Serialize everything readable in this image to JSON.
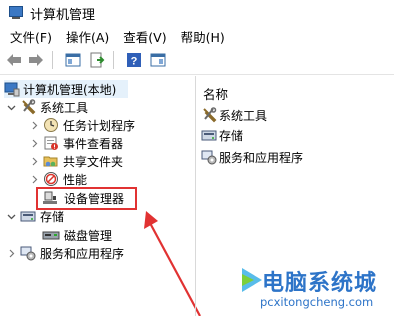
{
  "window": {
    "title": "计算机管理"
  },
  "menu": {
    "items": [
      "文件(F)",
      "操作(A)",
      "查看(V)",
      "帮助(H)"
    ]
  },
  "toolbar": {
    "icons": [
      "back-arrow-icon",
      "forward-arrow-icon",
      "show-hide-tree-icon",
      "export-list-icon",
      "help-icon",
      "show-action-pane-icon"
    ]
  },
  "tree": {
    "root": "计算机管理(本地)",
    "system_tools": "系统工具",
    "task_scheduler": "任务计划程序",
    "event_viewer": "事件查看器",
    "shared_folders": "共享文件夹",
    "performance": "性能",
    "device_manager": "设备管理器",
    "storage": "存储",
    "disk_management": "磁盘管理",
    "services_apps": "服务和应用程序"
  },
  "list": {
    "column_name": "名称",
    "items": [
      "系统工具",
      "存储",
      "服务和应用程序"
    ]
  },
  "watermark": {
    "title": "电脑系统城",
    "url": "pcxitongcheng.com"
  },
  "colors": {
    "highlight_box": "#e13232",
    "arrow": "#e13232",
    "watermark": "#2d74c8",
    "selection": "#e5f1fb"
  }
}
